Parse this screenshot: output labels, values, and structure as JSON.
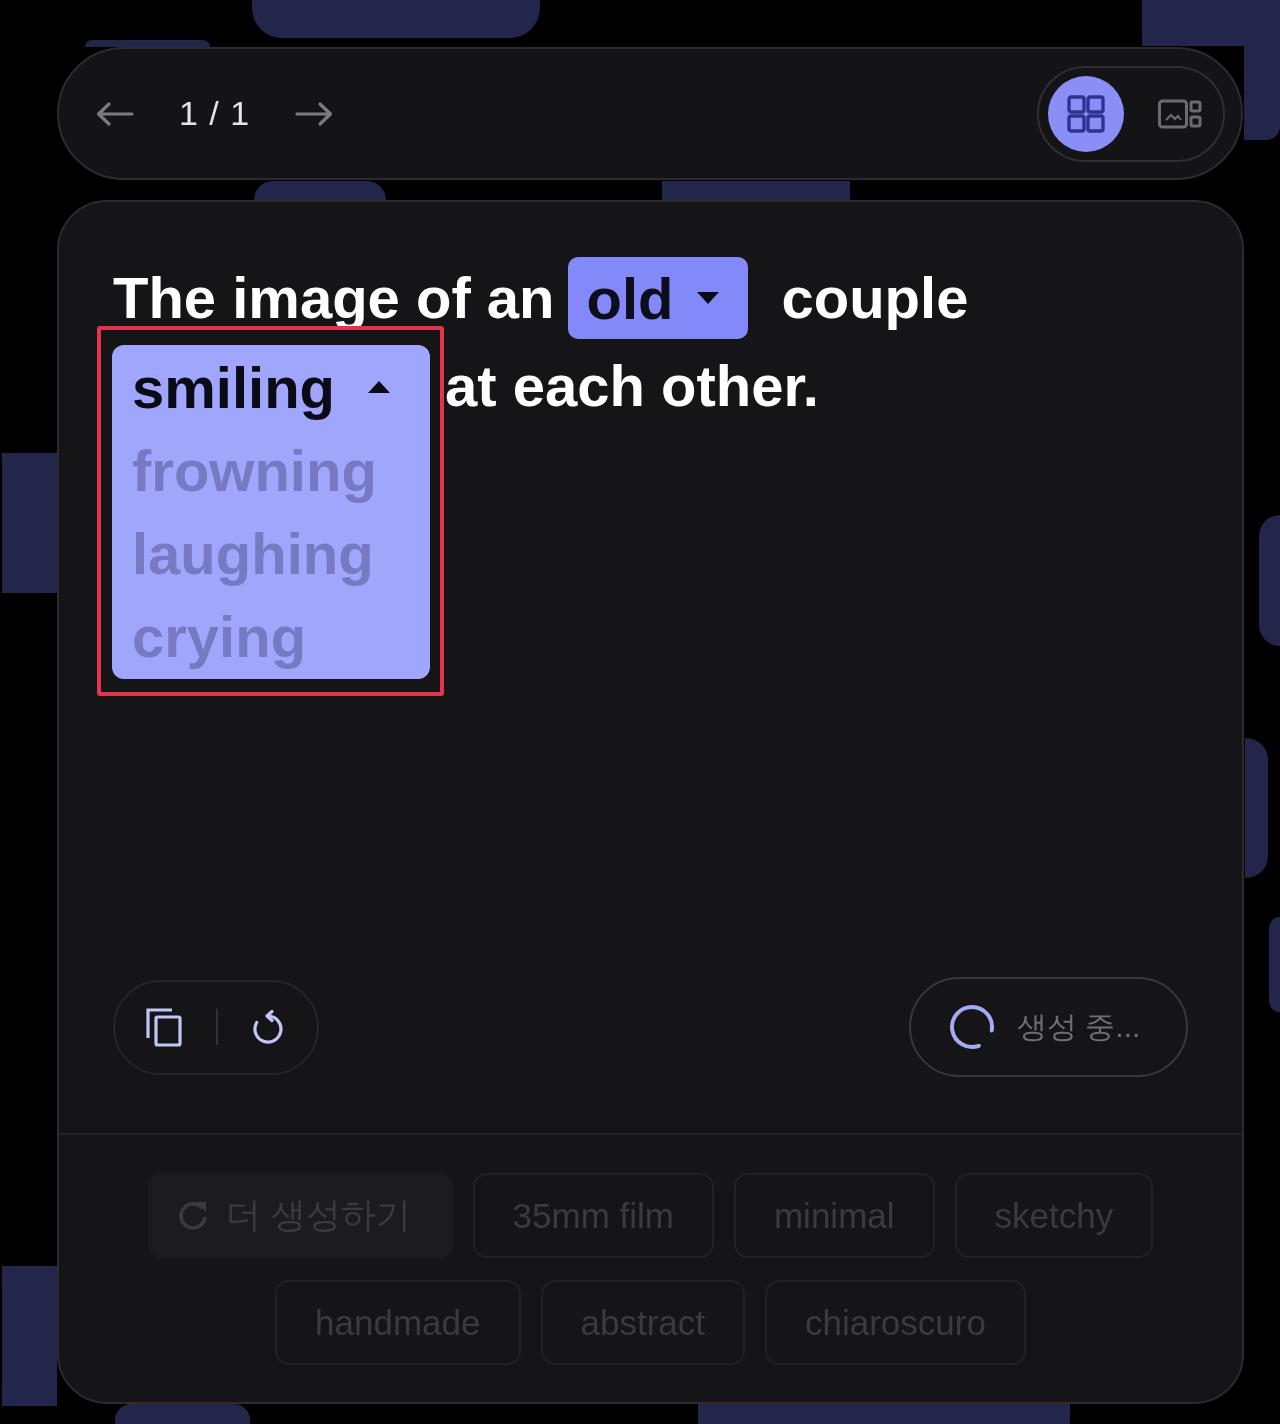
{
  "pager": {
    "label": "1 / 1"
  },
  "view_toggle": [
    {
      "kind": "grid",
      "selected": true
    },
    {
      "kind": "gallery",
      "selected": false
    }
  ],
  "prompt": {
    "segments": [
      {
        "kind": "text",
        "text": "The image of an"
      },
      {
        "kind": "choice",
        "value": "old",
        "expanded": false,
        "highlighted": false
      },
      {
        "kind": "text",
        "text": "couple"
      },
      {
        "kind": "choice",
        "value": "smiling",
        "expanded": true,
        "highlighted": true,
        "options": [
          "frowning",
          "laughing",
          "crying"
        ]
      },
      {
        "kind": "text",
        "text": "at each other."
      }
    ]
  },
  "status": {
    "label": "생성 중...",
    "busy": true
  },
  "suggestions": {
    "more_button": {
      "label": "더 생성하기",
      "disabled": true
    },
    "chips": [
      {
        "label": "35mm film",
        "disabled": true
      },
      {
        "label": "minimal",
        "disabled": true
      },
      {
        "label": "sketchy",
        "disabled": true
      },
      {
        "label": "handmade",
        "disabled": true
      },
      {
        "label": "abstract",
        "disabled": true
      },
      {
        "label": "chiaroscuro",
        "disabled": true
      }
    ]
  }
}
